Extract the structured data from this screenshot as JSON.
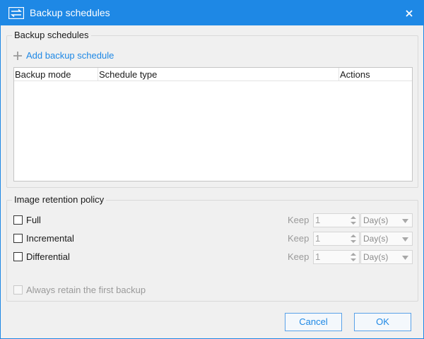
{
  "window": {
    "title": "Backup schedules",
    "accent": "#1e88e5",
    "icons": {
      "app": "backup-arrows-icon",
      "close": "close-icon"
    }
  },
  "schedules": {
    "legend": "Backup schedules",
    "add_label": "Add backup schedule",
    "columns": [
      "Backup mode",
      "Schedule type",
      "Actions"
    ],
    "rows": []
  },
  "retention": {
    "legend": "Image retention policy",
    "rows": [
      {
        "label": "Full",
        "checked": false,
        "keep_label": "Keep",
        "value": "1",
        "unit": "Day(s)"
      },
      {
        "label": "Incremental",
        "checked": false,
        "keep_label": "Keep",
        "value": "1",
        "unit": "Day(s)"
      },
      {
        "label": "Differential",
        "checked": false,
        "keep_label": "Keep",
        "value": "1",
        "unit": "Day(s)"
      }
    ],
    "retain_first": {
      "label": "Always retain the first backup",
      "checked": false,
      "disabled": true
    }
  },
  "footer": {
    "cancel_label": "Cancel",
    "ok_label": "OK"
  }
}
